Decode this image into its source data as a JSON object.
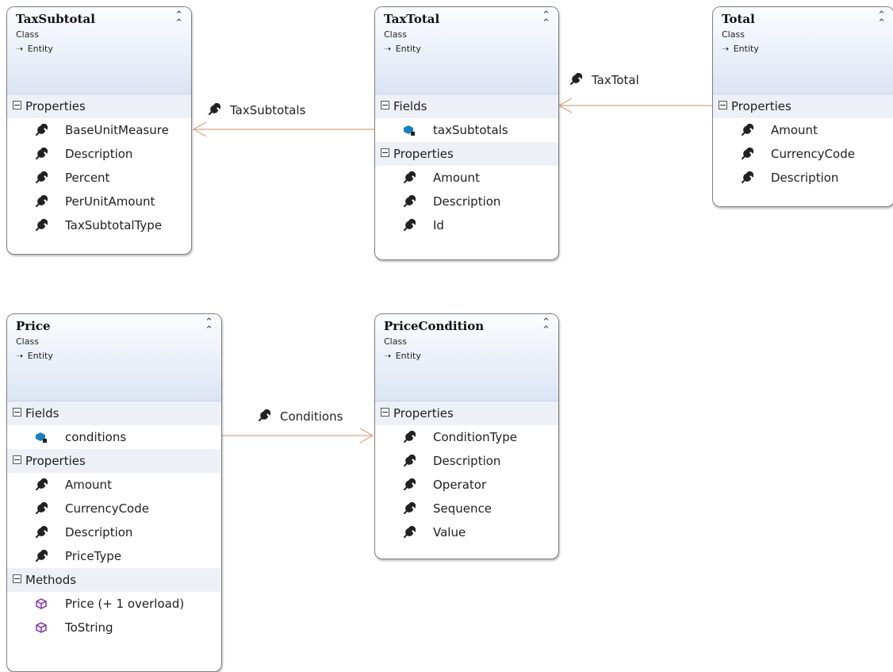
{
  "classes": {
    "tax_subtotal": {
      "name": "TaxSubtotal",
      "kind": "Class",
      "base": "Entity",
      "sections": [
        {
          "title": "Properties",
          "members": [
            "BaseUnitMeasure",
            "Description",
            "Percent",
            "PerUnitAmount",
            "TaxSubtotalType"
          ]
        }
      ]
    },
    "tax_total": {
      "name": "TaxTotal",
      "kind": "Class",
      "base": "Entity",
      "sections": [
        {
          "title": "Fields",
          "members": [
            "taxSubtotals"
          ]
        },
        {
          "title": "Properties",
          "members": [
            "Amount",
            "Description",
            "Id"
          ]
        }
      ]
    },
    "total": {
      "name": "Total",
      "kind": "Class",
      "base": "Entity",
      "sections": [
        {
          "title": "Properties",
          "members": [
            "Amount",
            "CurrencyCode",
            "Description"
          ]
        }
      ]
    },
    "price": {
      "name": "Price",
      "kind": "Class",
      "base": "Entity",
      "sections": [
        {
          "title": "Fields",
          "members": [
            "conditions"
          ]
        },
        {
          "title": "Properties",
          "members": [
            "Amount",
            "CurrencyCode",
            "Description",
            "PriceType"
          ]
        },
        {
          "title": "Methods",
          "members": [
            "Price (+ 1 overload)",
            "ToString"
          ]
        }
      ]
    },
    "price_condition": {
      "name": "PriceCondition",
      "kind": "Class",
      "base": "Entity",
      "sections": [
        {
          "title": "Properties",
          "members": [
            "ConditionType",
            "Description",
            "Operator",
            "Sequence",
            "Value"
          ]
        }
      ]
    }
  },
  "associations": {
    "tax_subtotals": "TaxSubtotals",
    "tax_total": "TaxTotal",
    "conditions": "Conditions"
  },
  "icons": {
    "property": "wrench-icon",
    "field": "field-icon",
    "method": "method-icon",
    "collapse": "double-chevron-up-icon",
    "inherit": "inheritance-arrow-icon"
  },
  "colors": {
    "connector": "#d8a482",
    "header_gradient_bottom": "#dce4f3",
    "section_bg": "#edf1f7",
    "method_icon": "#8b3fb0",
    "field_icon": "#1a7fc1"
  }
}
